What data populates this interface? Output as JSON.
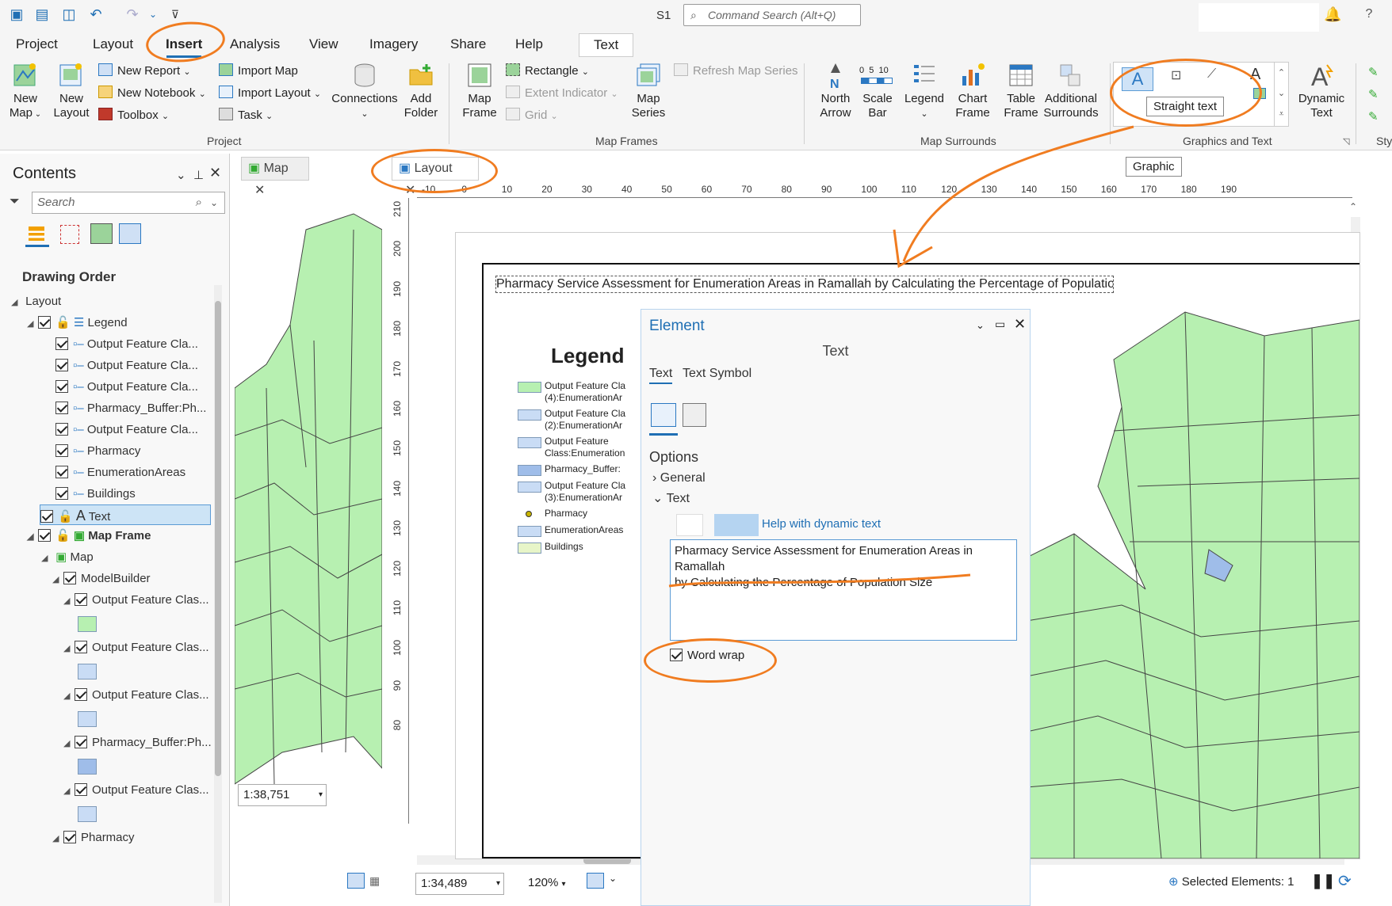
{
  "window": {
    "title": "S1",
    "command_search_placeholder": "Command Search (Alt+Q)"
  },
  "tabs": [
    "Project",
    "Layout",
    "Insert",
    "Analysis",
    "View",
    "Imagery",
    "Share",
    "Help",
    "Text"
  ],
  "active_tab": "Insert",
  "ribbon": {
    "project": {
      "label": "Project",
      "new_map": "New\nMap",
      "new_layout": "New\nLayout",
      "new_report": "New Report",
      "new_notebook": "New Notebook",
      "toolbox": "Toolbox",
      "import_map": "Import Map",
      "import_layout": "Import Layout",
      "task": "Task",
      "connections": "Connections",
      "add_folder": "Add\nFolder"
    },
    "map_frames": {
      "label": "Map Frames",
      "map_frame": "Map\nFrame",
      "rectangle": "Rectangle",
      "extent_indicator": "Extent Indicator",
      "grid": "Grid",
      "map_series": "Map\nSeries",
      "refresh": "Refresh Map Series"
    },
    "map_surrounds": {
      "label": "Map Surrounds",
      "north_arrow": "North\nArrow",
      "scale_bar": "Scale\nBar",
      "scale_bar_ticks": "0  5  10",
      "legend": "Legend",
      "chart_frame": "Chart\nFrame",
      "table_frame": "Table\nFrame",
      "additional": "Additional\nSurrounds"
    },
    "graphics_text": {
      "label": "Graphics and Text",
      "dynamic_text": "Dynamic\nText",
      "tooltip_straight": "Straight text",
      "tooltip_graphic": "Graphic"
    },
    "partial_label": "Sty"
  },
  "contents": {
    "title": "Contents",
    "search_placeholder": "Search",
    "drawing_order": "Drawing Order",
    "rows": [
      {
        "label": "Layout"
      },
      {
        "label": "Legend"
      },
      {
        "label": "Output Feature Cla..."
      },
      {
        "label": "Output Feature Cla..."
      },
      {
        "label": "Output Feature Cla..."
      },
      {
        "label": "Pharmacy_Buffer:Ph..."
      },
      {
        "label": "Output Feature Cla..."
      },
      {
        "label": "Pharmacy"
      },
      {
        "label": "EnumerationAreas"
      },
      {
        "label": "Buildings"
      },
      {
        "label": "Text"
      },
      {
        "label": "Map Frame"
      },
      {
        "label": "Map"
      },
      {
        "label": "ModelBuilder"
      },
      {
        "label": "Output Feature Clas..."
      },
      {
        "label": "Output Feature Clas..."
      },
      {
        "label": "Output Feature Clas..."
      },
      {
        "label": "Pharmacy_Buffer:Ph..."
      },
      {
        "label": "Output Feature Clas..."
      },
      {
        "label": "Pharmacy"
      }
    ]
  },
  "views": {
    "map_tab": "Map",
    "layout_tab": "Layout"
  },
  "ruler_h": [
    "-10",
    "0",
    "10",
    "20",
    "30",
    "40",
    "50",
    "60",
    "70",
    "80",
    "90",
    "100",
    "110",
    "120",
    "130",
    "140",
    "150",
    "160",
    "170",
    "180",
    "190"
  ],
  "ruler_v": [
    "210",
    "200",
    "190",
    "180",
    "170",
    "160",
    "150",
    "140",
    "130",
    "120",
    "110",
    "100",
    "90",
    "80"
  ],
  "layout": {
    "title_text": "Pharmacy Service Assessment for Enumeration Areas in Ramallah by Calculating the Percentage of Population Size",
    "legend_title": "Legend",
    "legend_items": [
      {
        "label": "Output Feature Cla\n(4):EnumerationAr",
        "color": "#b7f0b1"
      },
      {
        "label": "Output Feature Cla\n(2):EnumerationAr",
        "color": "#c9dcf5"
      },
      {
        "label": "Output Feature\nClass:Enumeration",
        "color": "#c9dcf5"
      },
      {
        "label": "Pharmacy_Buffer:",
        "color": "#9fbde9"
      },
      {
        "label": "Output Feature Cla\n(3):EnumerationAr",
        "color": "#c9dcf5"
      },
      {
        "label": "Pharmacy",
        "color": "#c8b400"
      },
      {
        "label": "EnumerationAreas",
        "color": "#c9dcf5"
      },
      {
        "label": "Buildings",
        "color": "#e7f5c8"
      }
    ]
  },
  "element_pane": {
    "title": "Element",
    "subtitle": "Text",
    "tabs": [
      "Text",
      "Text Symbol"
    ],
    "options": "Options",
    "general": "General",
    "text_section": "Text",
    "help_dynamic": "Help with dynamic text",
    "text_value": "Pharmacy Service Assessment for Enumeration Areas in Ramallah\nby Calculating the Percentage of Population Size",
    "word_wrap": "Word wrap"
  },
  "status": {
    "map_scale": "1:38,751",
    "layout_scale": "1:34,489",
    "zoom": "120%",
    "selected": "Selected Elements: 1"
  },
  "colors": {
    "accent": "#1f6fb4",
    "annotation": "#f07c20",
    "poly_fill": "#b7f0b1"
  }
}
